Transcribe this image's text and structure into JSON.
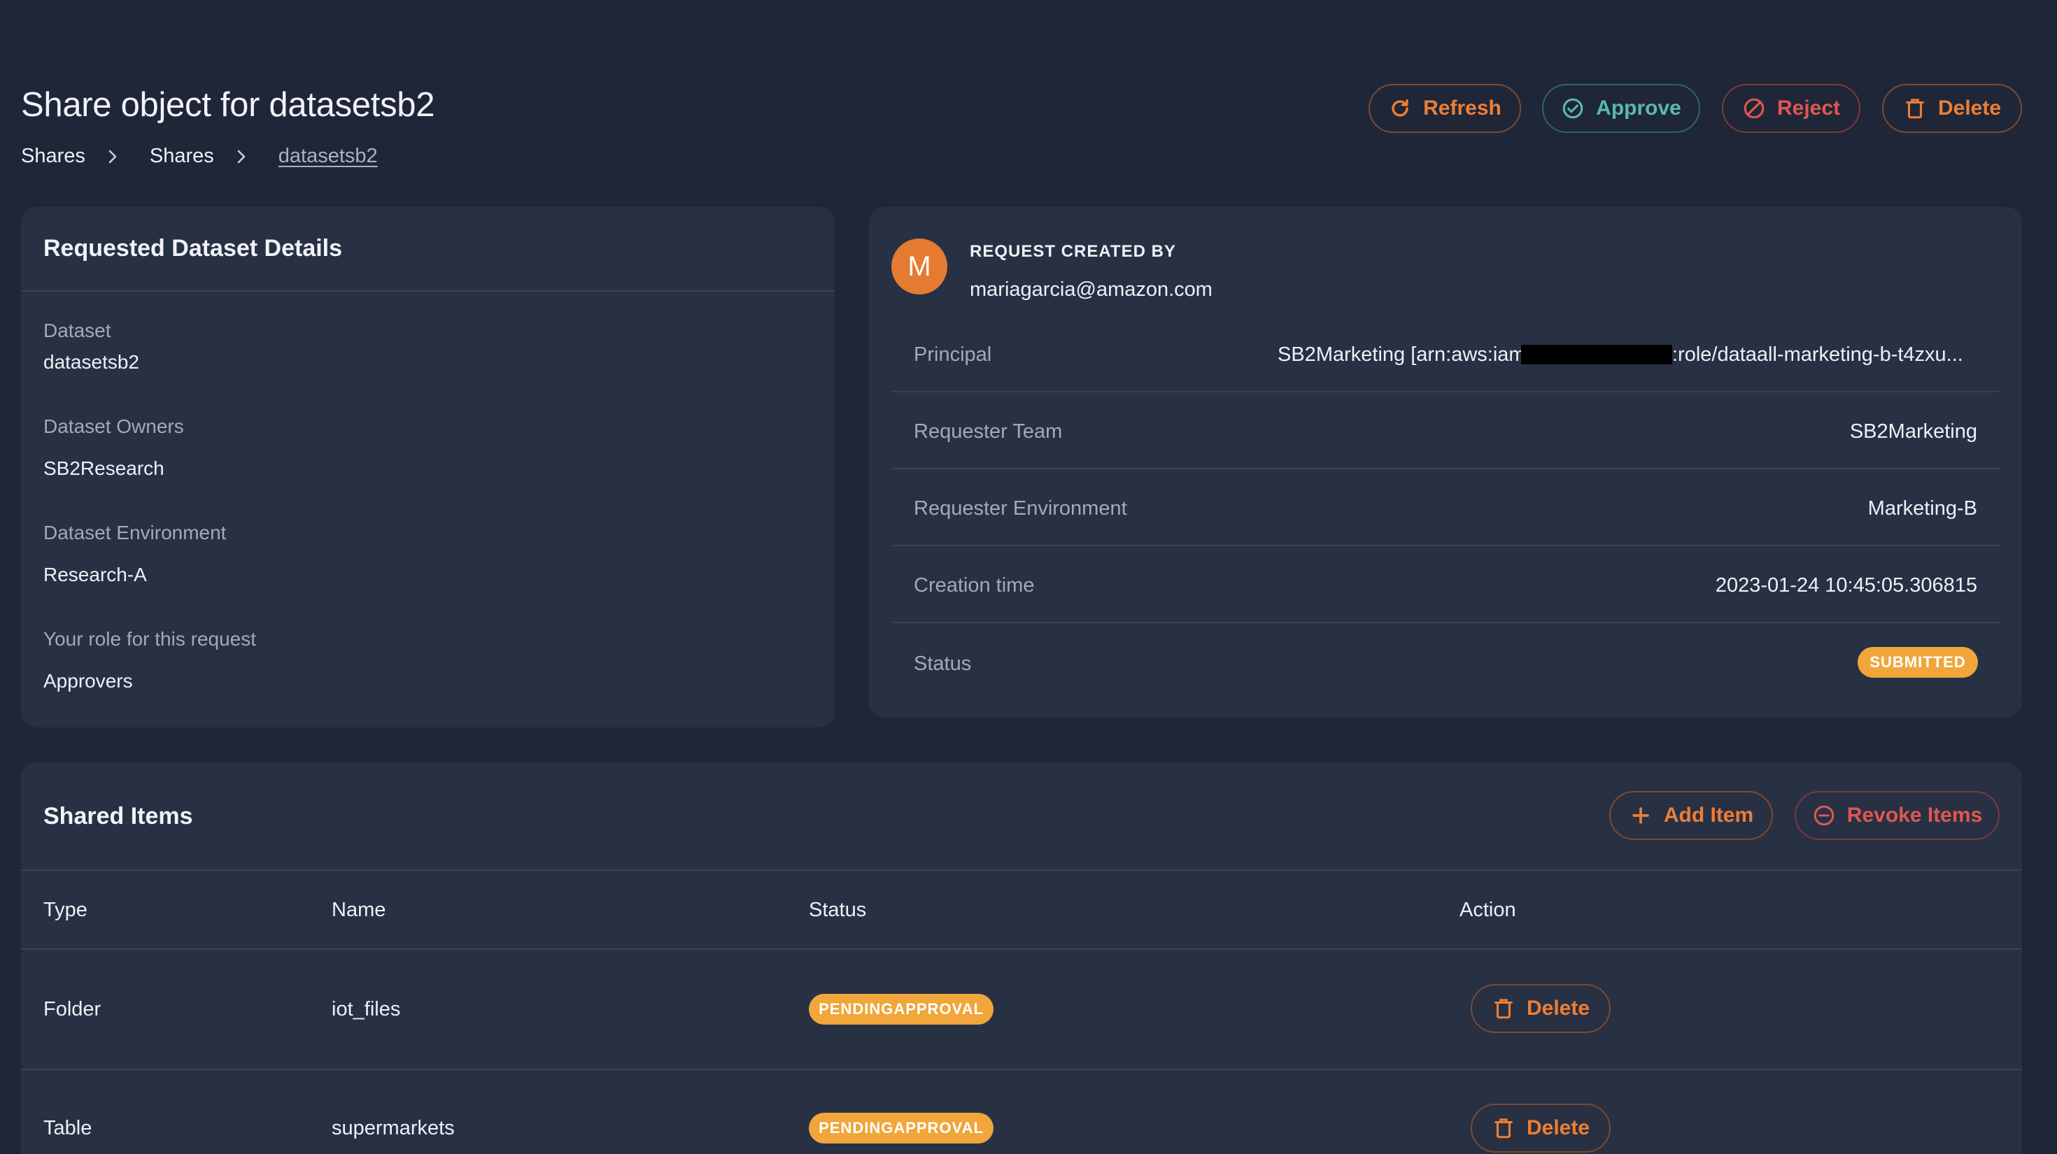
{
  "header": {
    "title": "Share object for datasetsb2",
    "breadcrumb": [
      "Shares",
      "Shares",
      "datasetsb2"
    ],
    "actions": {
      "refresh": "Refresh",
      "approve": "Approve",
      "reject": "Reject",
      "delete": "Delete"
    }
  },
  "dataset_details": {
    "title": "Requested Dataset Details",
    "fields": [
      {
        "label": "Dataset",
        "value": "datasetsb2"
      },
      {
        "label": "Dataset Owners",
        "value": "SB2Research"
      },
      {
        "label": "Dataset Environment",
        "value": "Research-A"
      },
      {
        "label": "Your role for this request",
        "value": "Approvers"
      }
    ]
  },
  "request": {
    "avatar_letter": "M",
    "created_by_label": "REQUEST CREATED BY",
    "created_by": "mariagarcia@amazon.com",
    "rows": [
      {
        "label": "Principal",
        "value_prefix": "SB2Marketing [arn:aws:iam",
        "value_suffix": ":role/dataall-marketing-b-t4zxu..."
      },
      {
        "label": "Requester Team",
        "value": "SB2Marketing"
      },
      {
        "label": "Requester Environment",
        "value": "Marketing-B"
      },
      {
        "label": "Creation time",
        "value": "2023-01-24 10:45:05.306815"
      },
      {
        "label": "Status",
        "value": "SUBMITTED"
      }
    ]
  },
  "shared_items": {
    "title": "Shared Items",
    "add_label": "Add Item",
    "revoke_label": "Revoke Items",
    "columns": [
      "Type",
      "Name",
      "Status",
      "Action"
    ],
    "rows": [
      {
        "type": "Folder",
        "name": "iot_files",
        "status": "PENDINGAPPROVAL",
        "action": "Delete"
      },
      {
        "type": "Table",
        "name": "supermarkets",
        "status": "PENDINGAPPROVAL",
        "action": "Delete"
      }
    ]
  },
  "colors": {
    "background": "#1f2638",
    "card": "#283044",
    "accent_orange": "#ee7e33",
    "approve_teal": "#5bb9a8",
    "reject_red": "#e0574f",
    "badge_amber": "#f0a63a"
  }
}
